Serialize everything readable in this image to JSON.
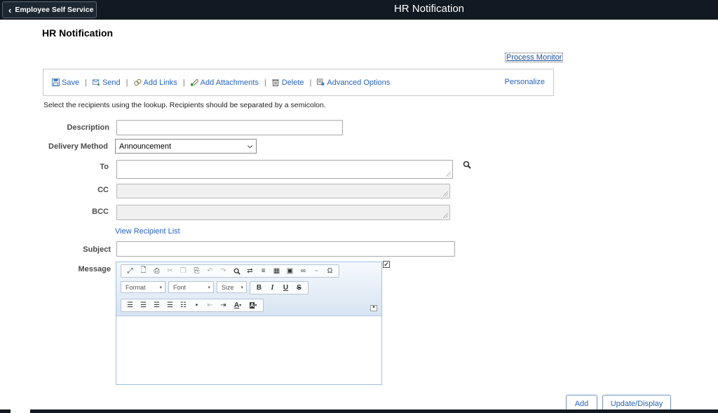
{
  "header": {
    "back_label": "Employee Self Service",
    "app_title": "HR Notification"
  },
  "page": {
    "title": "HR Notification",
    "process_monitor": "Process Monitor",
    "instructions": "Select the recipients using the lookup. Recipients should be separated by a semicolon."
  },
  "toolbar": {
    "items": [
      {
        "label": "Save",
        "icon": "save-icon"
      },
      {
        "label": "Send",
        "icon": "send-icon"
      },
      {
        "label": "Add Links",
        "icon": "add-links-icon"
      },
      {
        "label": "Add Attachments",
        "icon": "attachment-icon"
      },
      {
        "label": "Delete",
        "icon": "trash-icon"
      },
      {
        "label": "Advanced Options",
        "icon": "advanced-options-icon"
      }
    ],
    "personalize": "Personalize"
  },
  "form": {
    "description_label": "Description",
    "description_value": "",
    "delivery_label": "Delivery Method",
    "delivery_value": "Announcement",
    "to_label": "To",
    "to_value": "",
    "cc_label": "CC",
    "bcc_label": "BCC",
    "view_recipients": "View Recipient List",
    "subject_label": "Subject",
    "subject_value": "",
    "message_label": "Message"
  },
  "editor": {
    "format": "Format",
    "font": "Font",
    "size": "Size"
  },
  "buttons": {
    "add": "Add",
    "update_display": "Update/Display"
  },
  "colors": {
    "header_bg": "#111a22",
    "link": "#2864b8"
  }
}
